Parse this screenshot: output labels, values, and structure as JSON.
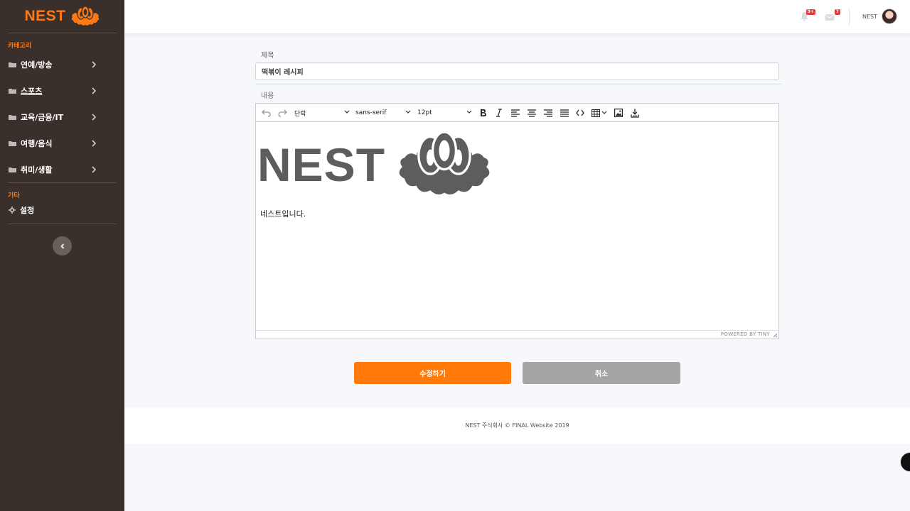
{
  "brand": {
    "name": "NEST"
  },
  "sidebar": {
    "category_heading": "카테고리",
    "items": [
      {
        "label": "연예/방송",
        "active": false
      },
      {
        "label": "스포츠",
        "active": true
      },
      {
        "label": "교육/금융/IT",
        "active": false
      },
      {
        "label": "여행/음식",
        "active": false
      },
      {
        "label": "취미/생활",
        "active": false
      }
    ],
    "etc_heading": "기타",
    "settings_label": "설정"
  },
  "topbar": {
    "alerts_badge": "9+",
    "messages_badge": "7",
    "user_name": "NEST"
  },
  "form": {
    "title_label": "제목",
    "title_value": "떡볶이 레시피",
    "content_label": "내용"
  },
  "editor": {
    "toolbar": {
      "block_format": "단락",
      "font_family": "sans-serif",
      "font_size": "12pt"
    },
    "logo_text": "NEST",
    "body_text": "네스트입니다.",
    "powered_by": "POWERED BY TINY"
  },
  "buttons": {
    "submit": "수정하기",
    "cancel": "취소"
  },
  "footer": {
    "text": "NEST 주식회사 © FINAL Website 2019"
  },
  "colors": {
    "accent": "#ff7a0b",
    "sidebar_bg": "#3a302b",
    "cancel": "#a5a5a5"
  }
}
